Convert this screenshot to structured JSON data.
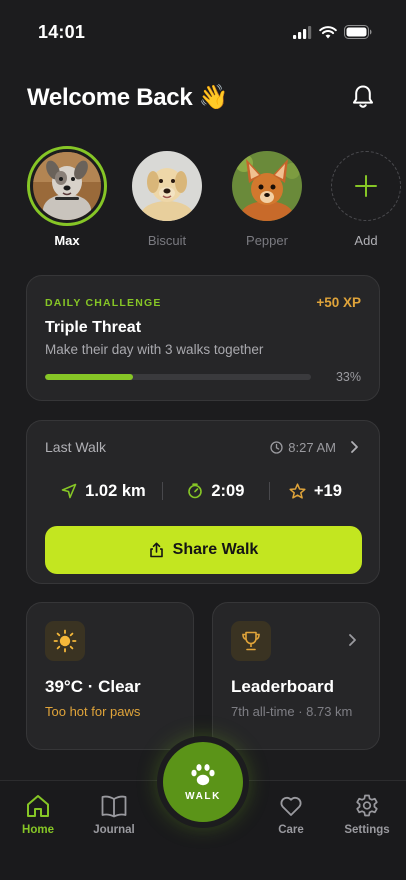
{
  "status": {
    "time": "14:01"
  },
  "header": {
    "welcome": "Welcome Back 👋"
  },
  "pets": [
    {
      "name": "Max",
      "active": true
    },
    {
      "name": "Biscuit",
      "active": false
    },
    {
      "name": "Pepper",
      "active": false
    }
  ],
  "add_pet_label": "Add",
  "challenge": {
    "label": "DAILY CHALLENGE",
    "xp": "+50 XP",
    "title": "Triple Threat",
    "description": "Make their day with 3 walks together",
    "progress_percent": "33%",
    "progress_fraction": 0.33
  },
  "last_walk": {
    "title": "Last Walk",
    "time": "8:27 AM",
    "distance": "1.02 km",
    "duration": "2:09",
    "points": "+19",
    "share_label": "Share Walk"
  },
  "weather": {
    "title": "39°C · Clear",
    "subtitle": "Too hot for paws"
  },
  "leaderboard": {
    "title": "Leaderboard",
    "subtitle": "7th all-time · 8.73 km"
  },
  "tabs": {
    "home": "Home",
    "journal": "Journal",
    "walk": "WALK",
    "care": "Care",
    "settings": "Settings"
  },
  "colors": {
    "accent_green": "#86c626",
    "button_lime": "#c3e620",
    "xp_orange": "#e0a43a",
    "background": "#1c1c1e",
    "card": "#262628"
  },
  "icons": {
    "status": [
      "signal-icon",
      "wifi-icon",
      "battery-icon"
    ],
    "bell": "bell-icon",
    "plus": "plus-icon",
    "clock": "clock-icon",
    "chevron": "chevron-right-icon",
    "location": "location-arrow-icon",
    "timer": "timer-icon",
    "star": "star-icon",
    "share": "share-icon",
    "sun": "sun-icon",
    "trophy": "trophy-icon",
    "paw": "paw-icon"
  }
}
